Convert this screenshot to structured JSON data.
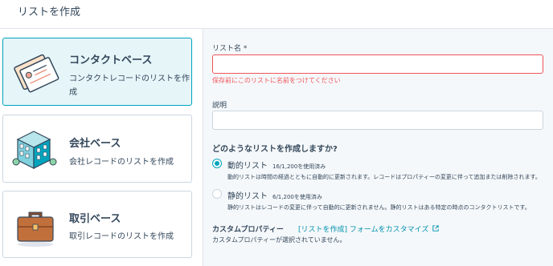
{
  "header": {
    "title": "リストを作成"
  },
  "cards": [
    {
      "title": "コンタクトベース",
      "description": "コンタクトレコードのリストを作成"
    },
    {
      "title": "会社ベース",
      "description": "会社レコードのリストを作成"
    },
    {
      "title": "取引ベース",
      "description": "取引レコードのリストを作成"
    }
  ],
  "form": {
    "list_name_label": "リスト名 *",
    "list_name_value": "",
    "list_name_error": "保存前にこのリストに名前をつけてください",
    "description_label": "説明",
    "description_value": "",
    "question": "どのようなリストを作成しますか?",
    "options": [
      {
        "title": "動的リスト",
        "usage": "16/1,200を使用済み",
        "description": "動的リストは時間の経過とともに自動的に更新されます。レコードはプロパティーの変更に伴って追加または削除されます。",
        "selected": true
      },
      {
        "title": "静的リスト",
        "usage": "6/1,200を使用済み",
        "description": "静的リストはレコードの変更に伴って自動的に更新されません。静的リストはある特定の時点のコンタクトリストです。",
        "selected": false
      }
    ],
    "custom_properties_title": "カスタムプロパティー",
    "custom_properties_link": "[リストを作成] フォームをカスタマイズ",
    "custom_properties_status": "カスタムプロパティーが選択されていません。"
  },
  "colors": {
    "accent": "#00a4bd",
    "error": "#f2545b",
    "link": "#0091ae",
    "text": "#33475b"
  },
  "icons": [
    "contact-cards-illustration",
    "company-building-illustration",
    "deal-briefcase-illustration",
    "external-link-icon"
  ]
}
